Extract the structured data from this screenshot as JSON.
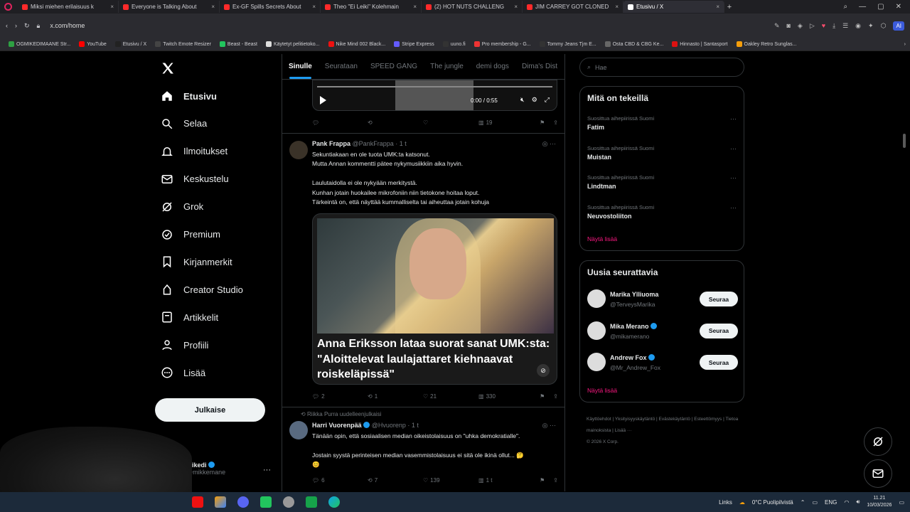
{
  "browser": {
    "tabs": [
      {
        "title": "Miksi miehen erilaisuus k",
        "active": false
      },
      {
        "title": "Everyone is Talking About",
        "active": false
      },
      {
        "title": "Ex-GF Spills Secrets About",
        "active": false
      },
      {
        "title": "Theo \"Ei Leiki\" Kolehmain",
        "active": false
      },
      {
        "title": "(2) HOT NUTS CHALLENG",
        "active": false
      },
      {
        "title": "JIM CARREY GOT CLONED",
        "active": false
      },
      {
        "title": "Etusivu / X",
        "active": true
      }
    ],
    "url": "x.com/home",
    "ai_label": "AI",
    "bookmarks": [
      {
        "label": "OGMIKEDIMAANE Str...",
        "color": "#2ea043"
      },
      {
        "label": "YouTube",
        "color": "#ff0000"
      },
      {
        "label": "Etusivu / X",
        "color": "#222"
      },
      {
        "label": "Twitch Emote Resizer",
        "color": "#444"
      },
      {
        "label": "Beast - Beast",
        "color": "#22c55e"
      },
      {
        "label": "Käytetyt pelitietoko...",
        "color": "#ddd"
      },
      {
        "label": "Nike Mind 002 Black...",
        "color": "#e11"
      },
      {
        "label": "Stripe Express",
        "color": "#635bff"
      },
      {
        "label": "uuno.fi",
        "color": "#333"
      },
      {
        "label": "Pro membership - G...",
        "color": "#e33"
      },
      {
        "label": "Tommy Jeans Tjm E...",
        "color": "#333"
      },
      {
        "label": "Osta CBD & CBG Ke...",
        "color": "#666"
      },
      {
        "label": "Hinnasto | Santasport",
        "color": "#d11"
      },
      {
        "label": "Oakley Retro Sunglas...",
        "color": "#f59e0b"
      }
    ]
  },
  "nav": {
    "items": [
      {
        "label": "Etusivu",
        "icon": "home-icon",
        "active": true
      },
      {
        "label": "Selaa",
        "icon": "search-icon",
        "active": false
      },
      {
        "label": "Ilmoitukset",
        "icon": "bell-icon",
        "active": false
      },
      {
        "label": "Keskustelu",
        "icon": "mail-icon",
        "active": false
      },
      {
        "label": "Grok",
        "icon": "grok-icon",
        "active": false
      },
      {
        "label": "Premium",
        "icon": "premium-icon",
        "active": false
      },
      {
        "label": "Kirjanmerkit",
        "icon": "bookmark-icon",
        "active": false
      },
      {
        "label": "Creator Studio",
        "icon": "creator-icon",
        "active": false
      },
      {
        "label": "Artikkelit",
        "icon": "article-icon",
        "active": false
      },
      {
        "label": "Profiili",
        "icon": "profile-icon",
        "active": false
      },
      {
        "label": "Lisää",
        "icon": "more-icon",
        "active": false
      }
    ],
    "post_button": "Julkaise",
    "account": {
      "name": "mikedi",
      "handle": "@mikkemane"
    }
  },
  "feed": {
    "tabs": [
      "Sinulle",
      "Seurataan",
      "SPEED GANG",
      "The jungle",
      "demi dogs",
      "Dima's Dist"
    ],
    "video": {
      "time": "0:00 / 0:55",
      "stats": {
        "views": "19"
      }
    },
    "tweet1": {
      "name": "Pank Frappa",
      "handle": "@PankFrappa",
      "time": "1 t",
      "text": "Sekuntiakaan en ole tuota UMK:ta katsonut.\nMutta Annan kommentti pätee nykymusiikkiin aika hyvin.\n\nLaulutaidolla ei ole nykyään merkitystä.\nKunhan jotain huokailee mikrofoniin niin tietokone hoitaa loput.\nTärkeintä on, että näyttää kummalliselta tai aiheuttaa jotain kohuja",
      "card_title": "Anna Eriksson lataa suorat sanat UMK:sta: \"Aloittelevat laulajattaret kiehnaavat roiskeläpissä\"",
      "stats": {
        "replies": "2",
        "reposts": "1",
        "likes": "21",
        "views": "330"
      }
    },
    "tweet2": {
      "repost_by": "Riikka Purra uudelleenjulkaisi",
      "name": "Harri Vuorenpää",
      "handle": "@Hvuorenp",
      "time": "1 t",
      "text": "Tänään opin, että sosiaalisen median oikeistolaisuus on \"uhka demokratialle\".\n\nJostain syystä perinteisen median vasemmistolaisuus ei sitä ole ikinä ollut... 🤔\n😊",
      "stats": {
        "replies": "6",
        "reposts": "7",
        "likes": "139",
        "views": "1 t"
      }
    }
  },
  "right": {
    "search_placeholder": "Hae",
    "trends_title": "Mitä on tekeillä",
    "trends": [
      {
        "category": "Suosittua aihepiirissä Suomi",
        "topic": "Fatim"
      },
      {
        "category": "Suosittua aihepiirissä Suomi",
        "topic": "Muistan"
      },
      {
        "category": "Suosittua aihepiirissä Suomi",
        "topic": "Lindtman"
      },
      {
        "category": "Suosittua aihepiirissä Suomi",
        "topic": "Neuvostoliiton"
      }
    ],
    "show_more": "Näytä lisää",
    "who_title": "Uusia seurattavia",
    "who": [
      {
        "name": "Marika Ylliuoma",
        "handle": "@TerveysMarika",
        "verified": false
      },
      {
        "name": "Mika Merano",
        "handle": "@mikamerano",
        "verified": true
      },
      {
        "name": "Andrew Fox",
        "handle": "@Mr_Andrew_Fox",
        "verified": true
      }
    ],
    "follow_label": "Seuraa",
    "footer": "Käyttöehdot | Yksityisyyskäytäntö | Evästekäytäntö | Esteettömyys | Tietoa mainoksista | Lisää ···\n© 2026 X Corp."
  },
  "taskbar": {
    "links_label": "Links",
    "weather": "0°C Puolipilvistä",
    "lang": "ENG",
    "time": "11.21",
    "date": "10/03/2026"
  },
  "colors": {
    "accent": "#1d9bf0",
    "pink": "#f91880",
    "bg": "#000000"
  }
}
